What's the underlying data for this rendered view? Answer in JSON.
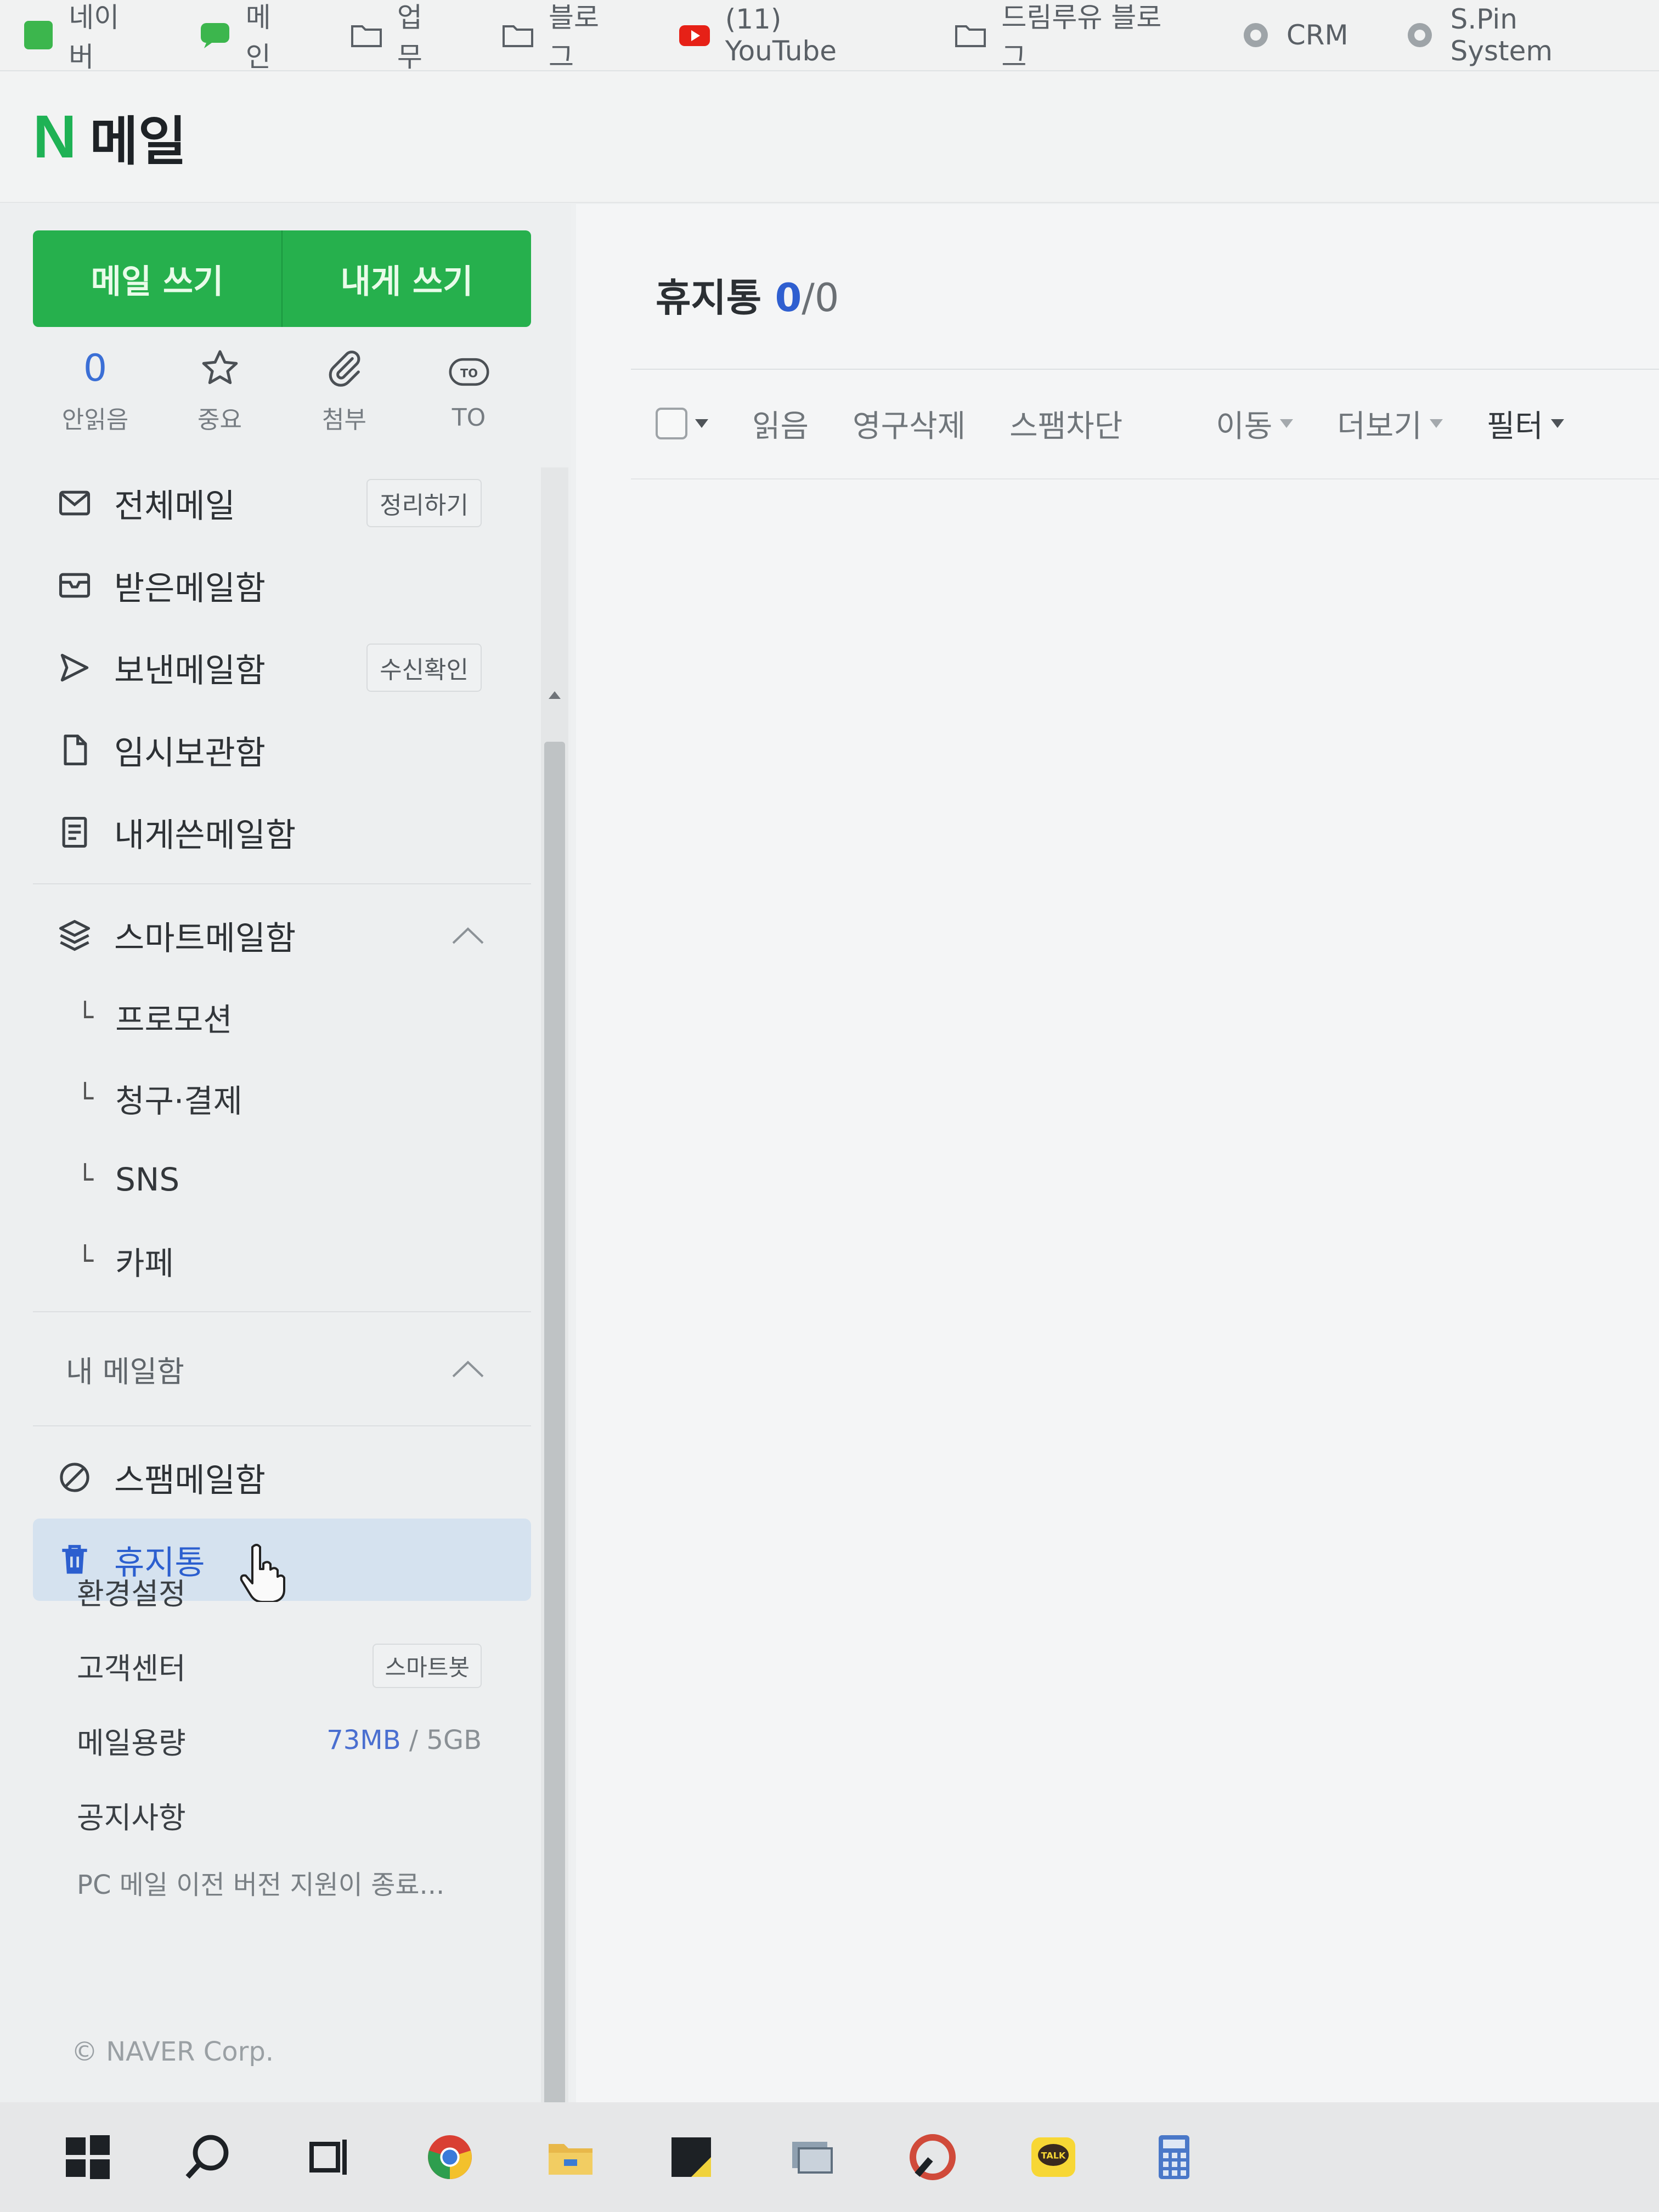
{
  "bookmarks": [
    {
      "label": "네이버",
      "icon": "naver-icon"
    },
    {
      "label": "메인",
      "icon": "talk-bubble-icon"
    },
    {
      "label": "업무",
      "icon": "folder-icon"
    },
    {
      "label": "블로그",
      "icon": "folder-icon"
    },
    {
      "label": "(11) YouTube",
      "icon": "youtube-icon"
    },
    {
      "label": "드림루유 블로그",
      "icon": "folder-icon"
    },
    {
      "label": "CRM",
      "icon": "globe-icon"
    },
    {
      "label": "S.Pin System",
      "icon": "globe-icon"
    }
  ],
  "header": {
    "logo_letter": "N",
    "title": "메일"
  },
  "compose": {
    "write": "메일 쓰기",
    "write_self": "내게 쓰기"
  },
  "quick_filters": [
    {
      "top": "0",
      "label": "안읽음"
    },
    {
      "label": "중요",
      "icon": "star-icon"
    },
    {
      "label": "첨부",
      "icon": "paperclip-icon"
    },
    {
      "label": "TO",
      "icon": "to-icon",
      "icon_text": "TO"
    }
  ],
  "folders": [
    {
      "label": "전체메일",
      "icon": "mail-icon",
      "pill": "정리하기"
    },
    {
      "label": "받은메일함",
      "icon": "inbox-icon"
    },
    {
      "label": "보낸메일함",
      "icon": "send-icon",
      "pill": "수신확인"
    },
    {
      "label": "임시보관함",
      "icon": "draft-icon"
    },
    {
      "label": "내게쓴메일함",
      "icon": "note-icon"
    }
  ],
  "smart": {
    "label": "스마트메일함",
    "icon": "layers-icon",
    "items": [
      "프로모션",
      "청구·결제",
      "SNS",
      "카페"
    ]
  },
  "my_mailbox": {
    "title": "내 메일함",
    "items": [
      {
        "label": "스팸메일함",
        "icon": "ban-icon"
      },
      {
        "label": "휴지통",
        "icon": "trash-icon"
      }
    ]
  },
  "settings": {
    "prefs": "환경설정",
    "support": "고객센터",
    "support_pill": "스마트봇",
    "quota_label": "메일용량",
    "quota_used": "73MB",
    "quota_sep": "/",
    "quota_total": "5GB",
    "notice_title": "공지사항",
    "notice_text": "PC 메일 이전 버전 지원이 종료..."
  },
  "copyright": "© NAVER Corp.",
  "main": {
    "folder_title": "휴지통",
    "count": "0",
    "sep": "/",
    "total": "0",
    "toolbar": {
      "read": "읽음",
      "delete_forever": "영구삭제",
      "block_spam": "스팸차단",
      "move": "이동",
      "more": "더보기",
      "filter": "필터"
    }
  },
  "colors": {
    "accent": "#26b04d",
    "link": "#2f5fd0",
    "active_bg": "#d5e2ef"
  }
}
